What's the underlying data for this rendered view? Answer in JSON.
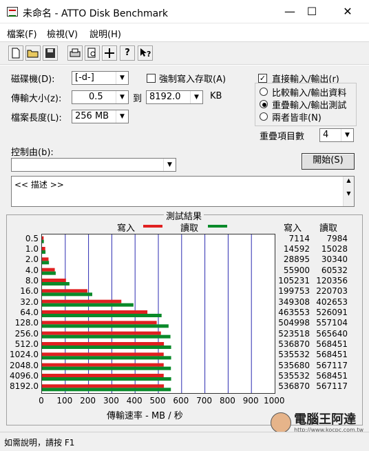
{
  "window": {
    "title": "未命名 - ATTO Disk Benchmark",
    "minimize": "—",
    "maximize": "☐",
    "close": "✕"
  },
  "menu": [
    "檔案(F)",
    "檢視(V)",
    "說明(H)"
  ],
  "toolbar": {
    "icons": [
      "new-file-icon",
      "open-folder-icon",
      "save-icon",
      "print-icon",
      "print-preview-icon",
      "move-icon",
      "help-icon",
      "context-help-icon"
    ]
  },
  "settings": {
    "drive_label": "磁碟機(D):",
    "drive_value": "[-d-]",
    "force_write_label": "強制寫入存取(A)",
    "force_write_checked": false,
    "direct_io_label": "直接輸入/輸出(r)",
    "direct_io_checked": true,
    "transfer_label": "傳輸大小(z):",
    "transfer_from": "0.5",
    "to_label": "到",
    "transfer_to": "8192.0",
    "unit": "KB",
    "filesize_label": "檔案長度(L):",
    "filesize_value": "256 MB",
    "radios": [
      {
        "label": "比較輸入/輸出資料",
        "selected": false
      },
      {
        "label": "重疊輸入/輸出測試",
        "selected": true
      },
      {
        "label": "兩者皆非(N)",
        "selected": false
      }
    ],
    "queue_label": "重疊項目數",
    "queue_value": "4",
    "control_label": "控制由(b):",
    "control_value": "",
    "start_button": "開始(S)",
    "description": "<< 描述 >>"
  },
  "results": {
    "title": "測試結果",
    "write_legend": "寫入",
    "read_legend": "讀取",
    "write_header": "寫入",
    "read_header": "讀取",
    "xlabel": "傳輸速率 - MB / 秒",
    "write_color": "#e02020",
    "read_color": "#0a8a2a"
  },
  "chart_data": {
    "type": "bar",
    "orientation": "horizontal",
    "title": "測試結果",
    "xlabel": "傳輸速率 - MB / 秒",
    "xlim": [
      0,
      1000
    ],
    "xticks": [
      "0",
      "100",
      "200",
      "300",
      "400",
      "500",
      "600",
      "700",
      "800",
      "900",
      "1000"
    ],
    "categories": [
      "0.5",
      "1.0",
      "2.0",
      "4.0",
      "8.0",
      "16.0",
      "32.0",
      "64.0",
      "128.0",
      "256.0",
      "512.0",
      "1024.0",
      "2048.0",
      "4096.0",
      "8192.0"
    ],
    "series": [
      {
        "name": "寫入",
        "color": "#e02020",
        "values": [
          7,
          14,
          28,
          55,
          103,
          195,
          341,
          453,
          493,
          511,
          524,
          523,
          523,
          523,
          524
        ]
      },
      {
        "name": "讀取",
        "color": "#0a8a2a",
        "values": [
          8,
          15,
          30,
          59,
          118,
          216,
          393,
          514,
          544,
          552,
          555,
          555,
          554,
          555,
          554
        ]
      }
    ],
    "write_kb": [
      "7114",
      "14592",
      "28895",
      "55900",
      "105231",
      "199753",
      "349308",
      "463553",
      "504998",
      "523518",
      "536870",
      "535532",
      "535680",
      "535532",
      "536870"
    ],
    "read_kb": [
      "7984",
      "15028",
      "30340",
      "60532",
      "120356",
      "220703",
      "402653",
      "526091",
      "557104",
      "565640",
      "568451",
      "568451",
      "567117",
      "568451",
      "567117"
    ]
  },
  "status": "如需說明，請按 F1",
  "watermark": {
    "text": "電腦王阿達",
    "url": "http://www.kocpc.com.tw"
  }
}
